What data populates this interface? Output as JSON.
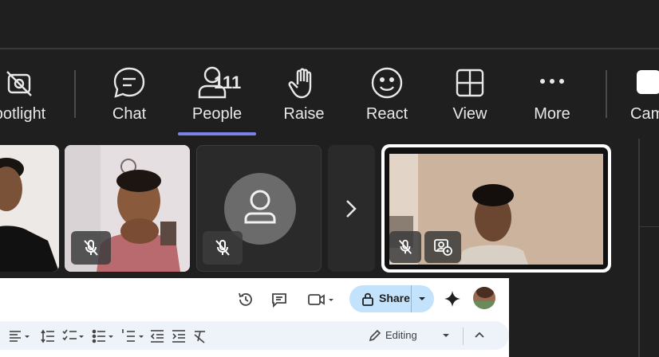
{
  "toolbar": {
    "spotlight_label": "potlight",
    "chat_label": "Chat",
    "people_label": "People",
    "people_count": "111",
    "raise_label": "Raise",
    "react_label": "React",
    "view_label": "View",
    "more_label": "More",
    "camera_label": "Cam"
  },
  "tiles": [
    {
      "name": "participant-1",
      "muted": true
    },
    {
      "name": "participant-2",
      "muted": true
    },
    {
      "name": "participant-3-no-video",
      "muted": true
    },
    {
      "name": "next-page"
    },
    {
      "name": "self-view",
      "muted": true
    }
  ],
  "docs": {
    "share_label": "Share",
    "editing_label": "Editing"
  },
  "colors": {
    "background": "#1f1f1f",
    "accent": "#7b83eb",
    "share_bg": "#c3e2fb"
  }
}
